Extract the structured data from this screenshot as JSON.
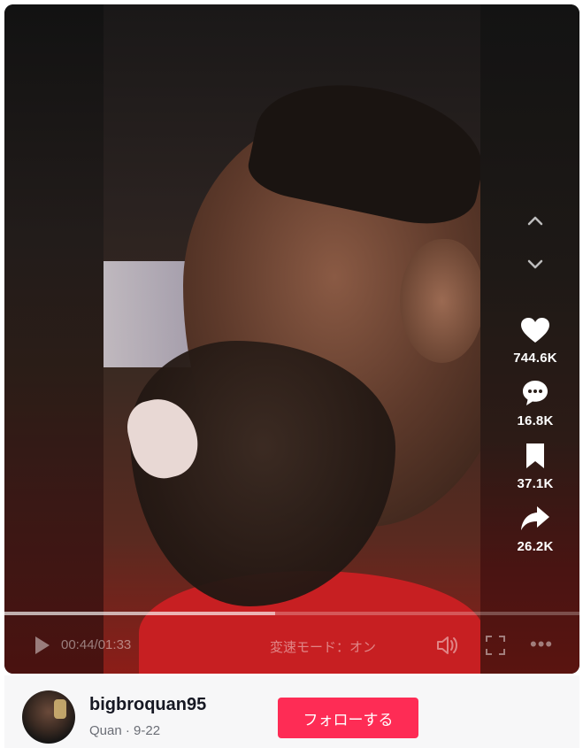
{
  "actions": {
    "likes": "744.6K",
    "comments": "16.8K",
    "saves": "37.1K",
    "shares": "26.2K"
  },
  "player": {
    "current_time": "00:44",
    "separator": "/",
    "duration": "01:33",
    "progress_fraction": 0.47,
    "speed_mode_label": "変速モード：オン",
    "more_label": "•••"
  },
  "author": {
    "username": "bigbroquan95",
    "nickname": "Quan",
    "dot": "·",
    "date": "9-22",
    "follow_label": "フォローする"
  },
  "colors": {
    "follow_button": "#fe2c55",
    "count_text": "#ffffff"
  },
  "icons": [
    "chevron-up-icon",
    "chevron-down-icon",
    "heart-icon",
    "comment-icon",
    "bookmark-icon",
    "share-icon",
    "play-icon",
    "volume-icon",
    "fullscreen-icon",
    "more-icon"
  ]
}
